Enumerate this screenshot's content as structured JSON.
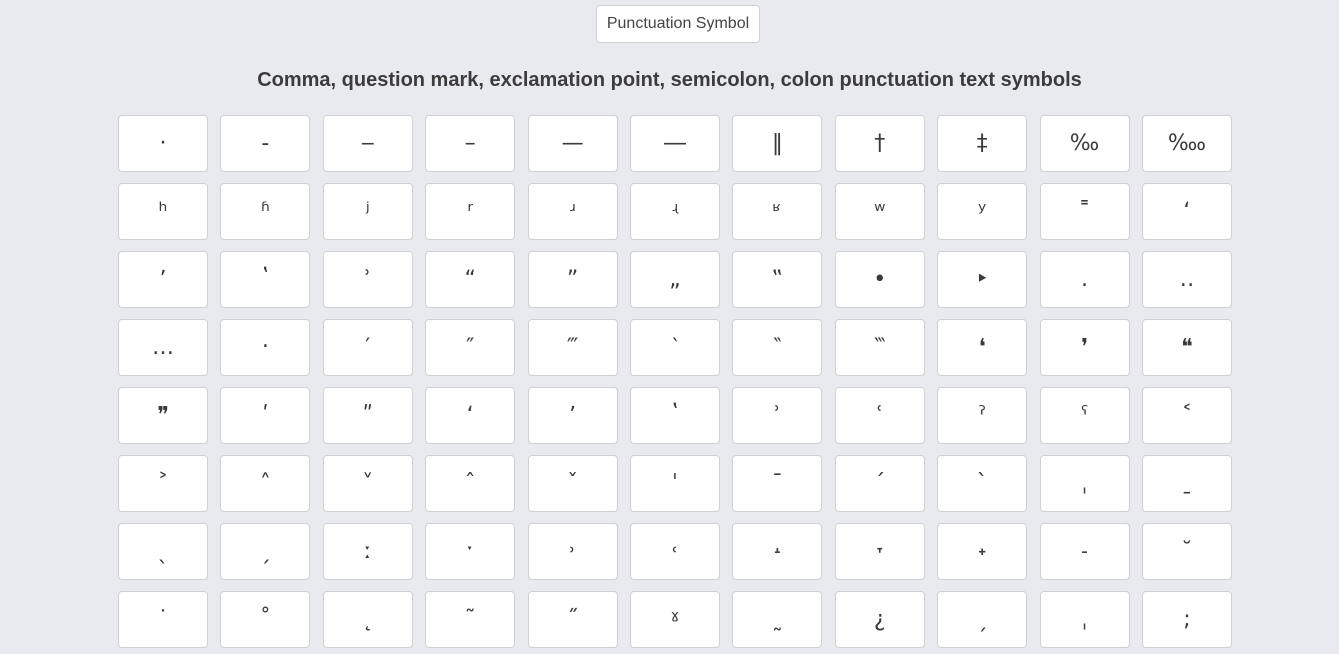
{
  "top_button": {
    "label": "Punctuation Symbol"
  },
  "heading": "Comma, question mark, exclamation point, semicolon, colon punctuation text symbols",
  "symbols": [
    "·",
    "‐",
    "‒",
    "–",
    "—",
    "―",
    "‖",
    "†",
    "‡",
    "‰",
    "‱",
    "ʰ",
    "ʱ",
    "ʲ",
    "ʳ",
    "ʴ",
    "ʵ",
    "ʶ",
    "ʷ",
    "ʸ",
    "˭",
    "ʻ",
    "ʼ",
    "ʽ",
    "ʾ",
    "“",
    "”",
    "„",
    "‟",
    "•",
    "‣",
    "․",
    "‥",
    "…",
    "‧",
    "′",
    "″",
    "‴",
    "‵",
    "‶",
    "‷",
    "❛",
    "❜",
    "❝",
    "❞",
    "ʹ",
    "ʺ",
    "ʻ",
    "ʼ",
    "ʽ",
    "ʾ",
    "ʿ",
    "ˀ",
    "ˁ",
    "˂",
    "˃",
    "˄",
    "˅",
    "ˆ",
    "ˇ",
    "ˈ",
    "ˉ",
    "ˊ",
    "ˋ",
    "ˌ",
    "ˍ",
    "ˎ",
    "ˏ",
    "ː",
    "ˑ",
    "˒",
    "˓",
    "˔",
    "˕",
    "˖",
    "˗",
    "˘",
    "˙",
    "˚",
    "˛",
    "˜",
    "˝",
    "ˠ",
    "˷",
    "¿",
    "ˏ",
    "ˌ",
    ";"
  ]
}
